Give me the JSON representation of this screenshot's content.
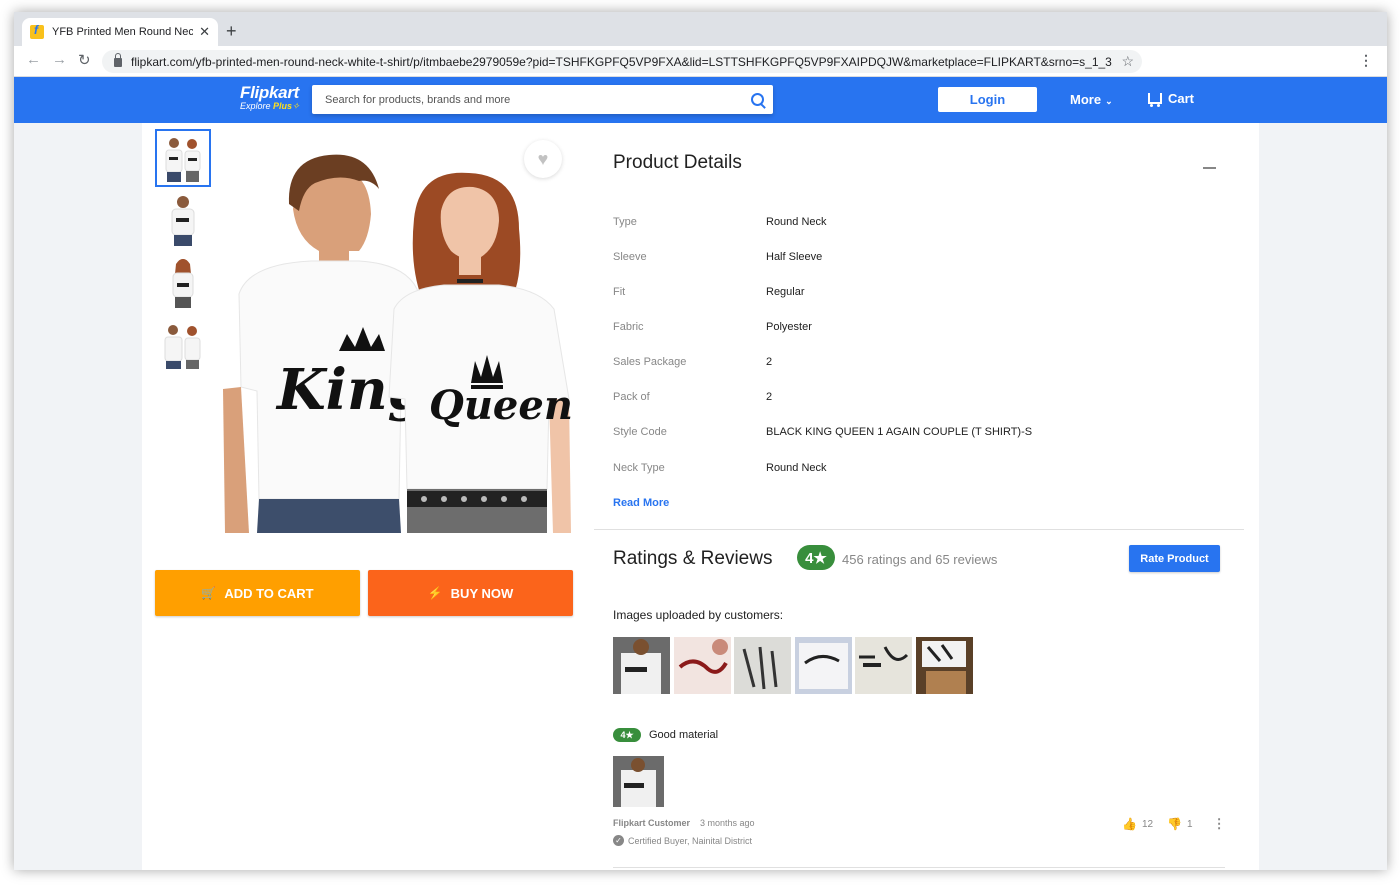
{
  "browser": {
    "tab_title": "YFB Printed Men Round Neck \\",
    "tab_close": "✕",
    "new_tab": "+",
    "back": "←",
    "forward": "→",
    "reload": "↻",
    "url": "flipkart.com/yfb-printed-men-round-neck-white-t-shirt/p/itmbaebe2979059e?pid=TSHFKGPFQ5VP9FXA&lid=LSTTSHFKGPFQ5VP9FXAIPDQJW&marketplace=FLIPKART&srno=s_1_3...",
    "bookmark": "☆",
    "menu": "⋮"
  },
  "header": {
    "logo": "Flipkart",
    "logo_sub": "Explore",
    "logo_plus": "Plus",
    "search_placeholder": "Search for products, brands and more",
    "login": "Login",
    "more": "More",
    "more_chevron": "⌄",
    "cart": "Cart",
    "brand_color": "#2874f0"
  },
  "product": {
    "wishlist_icon": "♥",
    "add_to_cart": "ADD TO CART",
    "add_to_cart_icon": "🛒",
    "buy_now": "BUY NOW",
    "buy_now_icon": "⚡",
    "print_king": "King",
    "print_queen": "Queen"
  },
  "details": {
    "title": "Product Details",
    "specs": [
      {
        "key": "Type",
        "value": "Round Neck"
      },
      {
        "key": "Sleeve",
        "value": "Half Sleeve"
      },
      {
        "key": "Fit",
        "value": "Regular"
      },
      {
        "key": "Fabric",
        "value": "Polyester"
      },
      {
        "key": "Sales Package",
        "value": "2"
      },
      {
        "key": "Pack of",
        "value": "2"
      },
      {
        "key": "Style Code",
        "value": "BLACK KING QUEEN 1 AGAIN COUPLE (T SHIRT)-S"
      },
      {
        "key": "Neck Type",
        "value": "Round Neck"
      }
    ],
    "read_more": "Read More"
  },
  "reviews": {
    "title": "Ratings & Reviews",
    "rating": "4★",
    "summary": "456 ratings and 65 reviews",
    "rate_button": "Rate Product",
    "images_heading": "Images uploaded by customers:",
    "review": {
      "rating": "4★",
      "title": "Good material",
      "author": "Flipkart Customer",
      "time": "3 months ago",
      "certified_icon": "✓",
      "certified": "Certified Buyer, Nainital District",
      "likes": "12",
      "dislikes": "1",
      "like_icon": "👍",
      "dislike_icon": "👎",
      "more_icon": "⋮"
    },
    "rating_color": "#388e3c"
  }
}
